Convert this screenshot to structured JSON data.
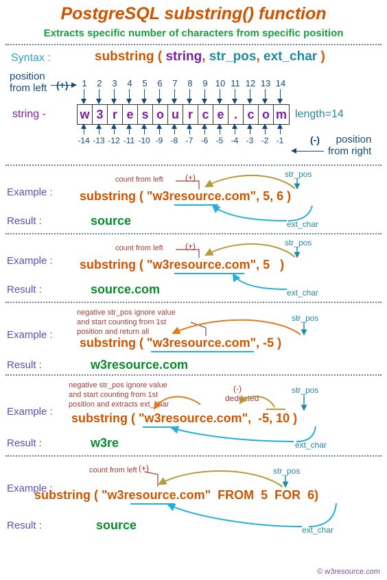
{
  "title": "PostgreSQL substring() function",
  "subtitle": "Extracts specific number of characters from specific position",
  "syntax_label": "Syntax :",
  "syntax": {
    "func": "substring",
    "open": " ( ",
    "arg1": "string",
    "sep1": ", ",
    "arg2": "str_pos",
    "sep2": ", ",
    "arg3": "ext_char",
    "close": " )"
  },
  "box": {
    "chars": [
      "w",
      "3",
      "r",
      "e",
      "s",
      "o",
      "u",
      "r",
      "c",
      "e",
      ".",
      "c",
      "o",
      "m"
    ],
    "pos": [
      "1",
      "2",
      "3",
      "4",
      "5",
      "6",
      "7",
      "8",
      "9",
      "10",
      "11",
      "12",
      "13",
      "14"
    ],
    "neg": [
      "-14",
      "-13",
      "-12",
      "-11",
      "-10",
      "-9",
      "-8",
      "-7",
      "-6",
      "-5",
      "-4",
      "-3",
      "-2",
      "-1"
    ],
    "string_label": "string -",
    "length_label": "length=14",
    "pos_from_left": "position\nfrom left",
    "pos_from_right": "position\nfrom right",
    "plus": "(+)",
    "minus": "(-)"
  },
  "ex_label": "Example :",
  "res_label": "Result :",
  "examples": [
    {
      "note": "count from left",
      "sign": "(+)",
      "code": "substring ( \"w3resource.com\", 5, 6 )",
      "result": "source",
      "str_pos": "str_pos",
      "ext_char": "ext_char"
    },
    {
      "note": "count from left",
      "sign": "(+)",
      "code": "substring ( \"w3resource.com\", 5   )",
      "result": "source.com",
      "str_pos": "str_pos",
      "ext_char": "ext_char"
    },
    {
      "note": "negative str_pos ignore value\nand start counting from 1st\nposition and return all",
      "code": "substring ( \"w3resource.com\", -5 )",
      "result": "w3resource.com",
      "str_pos": "str_pos"
    },
    {
      "note": "negative str_pos ignore value\nand start counting from 1st\nposition and extracts ext_char",
      "sign": "(-)",
      "deducted": "deducted",
      "code": "substring ( \"w3resource.com\",  -5, 10 )",
      "result": "w3re",
      "str_pos": "str_pos",
      "ext_char": "ext_char"
    },
    {
      "note": "count from left",
      "sign": "(+)",
      "code": "substring ( \"w3resource.com\"  FROM  5  FOR  6)",
      "result": "source",
      "str_pos": "str_pos",
      "ext_char": "ext_char"
    }
  ],
  "credit": "© w3resource.com"
}
